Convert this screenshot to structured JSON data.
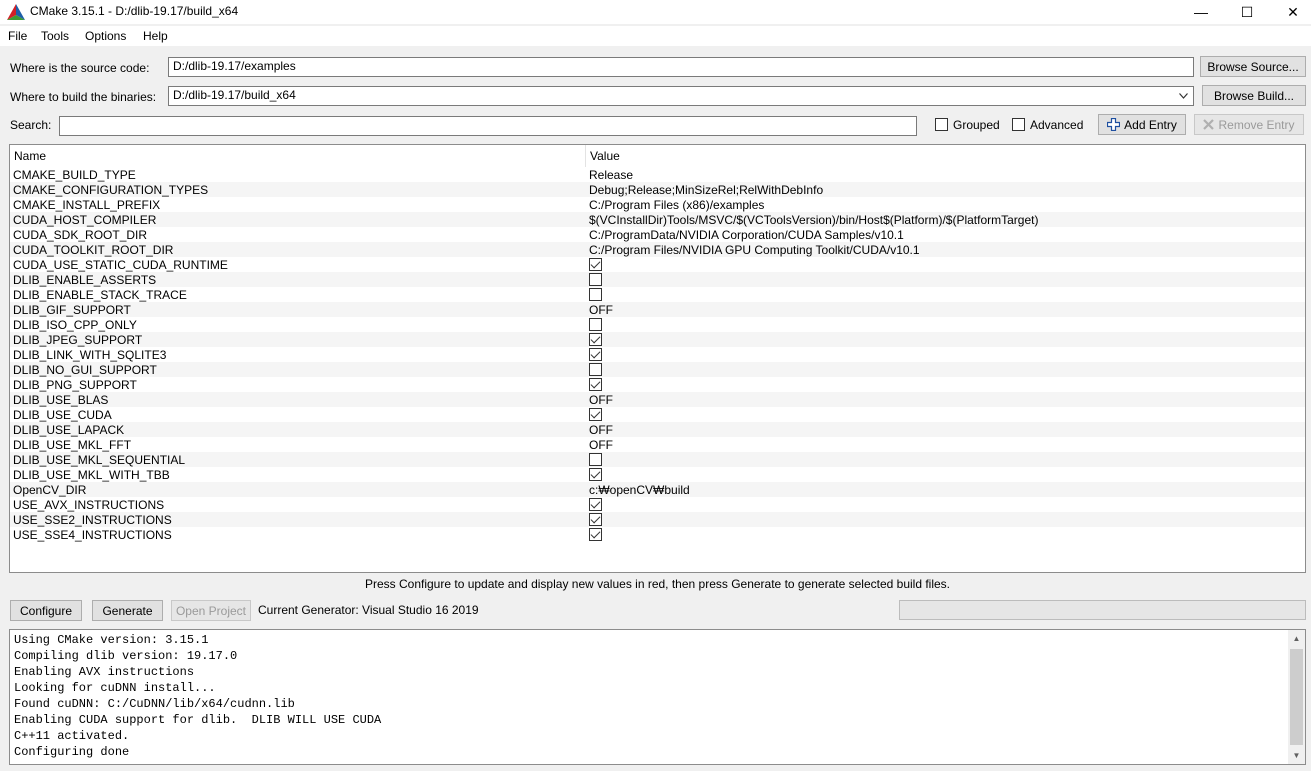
{
  "window": {
    "title": "CMake 3.15.1 - D:/dlib-19.17/build_x64",
    "minimize_glyph": "—",
    "maximize_glyph": "☐",
    "close_glyph": "✕"
  },
  "menu": [
    "File",
    "Tools",
    "Options",
    "Help"
  ],
  "source": {
    "label": "Where is the source code:",
    "value": "D:/dlib-19.17/examples",
    "browse_label": "Browse Source..."
  },
  "build": {
    "label": "Where to build the binaries:",
    "value": "D:/dlib-19.17/build_x64",
    "browse_label": "Browse Build..."
  },
  "search": {
    "label": "Search:",
    "value": "",
    "grouped_label": "Grouped",
    "grouped_checked": false,
    "advanced_label": "Advanced",
    "advanced_checked": false,
    "add_entry_label": "Add Entry",
    "remove_entry_label": "Remove Entry"
  },
  "table": {
    "headers": [
      "Name",
      "Value"
    ],
    "rows": [
      {
        "name": "CMAKE_BUILD_TYPE",
        "type": "text",
        "value": "Release"
      },
      {
        "name": "CMAKE_CONFIGURATION_TYPES",
        "type": "text",
        "value": "Debug;Release;MinSizeRel;RelWithDebInfo"
      },
      {
        "name": "CMAKE_INSTALL_PREFIX",
        "type": "text",
        "value": "C:/Program Files (x86)/examples"
      },
      {
        "name": "CUDA_HOST_COMPILER",
        "type": "text",
        "value": "$(VCInstallDir)Tools/MSVC/$(VCToolsVersion)/bin/Host$(Platform)/$(PlatformTarget)"
      },
      {
        "name": "CUDA_SDK_ROOT_DIR",
        "type": "text",
        "value": "C:/ProgramData/NVIDIA Corporation/CUDA Samples/v10.1"
      },
      {
        "name": "CUDA_TOOLKIT_ROOT_DIR",
        "type": "text",
        "value": "C:/Program Files/NVIDIA GPU Computing Toolkit/CUDA/v10.1"
      },
      {
        "name": "CUDA_USE_STATIC_CUDA_RUNTIME",
        "type": "bool",
        "checked": true
      },
      {
        "name": "DLIB_ENABLE_ASSERTS",
        "type": "bool",
        "checked": false
      },
      {
        "name": "DLIB_ENABLE_STACK_TRACE",
        "type": "bool",
        "checked": false
      },
      {
        "name": "DLIB_GIF_SUPPORT",
        "type": "text",
        "value": "OFF"
      },
      {
        "name": "DLIB_ISO_CPP_ONLY",
        "type": "bool",
        "checked": false
      },
      {
        "name": "DLIB_JPEG_SUPPORT",
        "type": "bool",
        "checked": true
      },
      {
        "name": "DLIB_LINK_WITH_SQLITE3",
        "type": "bool",
        "checked": true
      },
      {
        "name": "DLIB_NO_GUI_SUPPORT",
        "type": "bool",
        "checked": false
      },
      {
        "name": "DLIB_PNG_SUPPORT",
        "type": "bool",
        "checked": true
      },
      {
        "name": "DLIB_USE_BLAS",
        "type": "text",
        "value": "OFF"
      },
      {
        "name": "DLIB_USE_CUDA",
        "type": "bool",
        "checked": true
      },
      {
        "name": "DLIB_USE_LAPACK",
        "type": "text",
        "value": "OFF"
      },
      {
        "name": "DLIB_USE_MKL_FFT",
        "type": "text",
        "value": "OFF"
      },
      {
        "name": "DLIB_USE_MKL_SEQUENTIAL",
        "type": "bool",
        "checked": false
      },
      {
        "name": "DLIB_USE_MKL_WITH_TBB",
        "type": "bool",
        "checked": true
      },
      {
        "name": "OpenCV_DIR",
        "type": "text",
        "value": "c:₩openCV₩build"
      },
      {
        "name": "USE_AVX_INSTRUCTIONS",
        "type": "bool",
        "checked": true
      },
      {
        "name": "USE_SSE2_INSTRUCTIONS",
        "type": "bool",
        "checked": true
      },
      {
        "name": "USE_SSE4_INSTRUCTIONS",
        "type": "bool",
        "checked": true
      }
    ]
  },
  "status_message": "Press Configure to update and display new values in red, then press Generate to generate selected build files.",
  "actions": {
    "configure_label": "Configure",
    "generate_label": "Generate",
    "open_project_label": "Open Project",
    "generator_text": "Current Generator: Visual Studio 16 2019"
  },
  "output_lines": [
    "Using CMake version: 3.15.1",
    "Compiling dlib version: 19.17.0",
    "Enabling AVX instructions",
    "Looking for cuDNN install...",
    "Found cuDNN: C:/CuDNN/lib/x64/cudnn.lib",
    "Enabling CUDA support for dlib.  DLIB WILL USE CUDA",
    "C++11 activated.",
    "Configuring done"
  ],
  "icons": {
    "app": "cmake-triangle-icon",
    "add": "plus-icon",
    "remove": "x-icon",
    "dropdown": "chevron-down-icon"
  },
  "colors": {
    "cmake_red": "#d22027",
    "cmake_green": "#3d9b35",
    "cmake_blue": "#1e5fa8",
    "row_alt": "#f5f5f5"
  }
}
